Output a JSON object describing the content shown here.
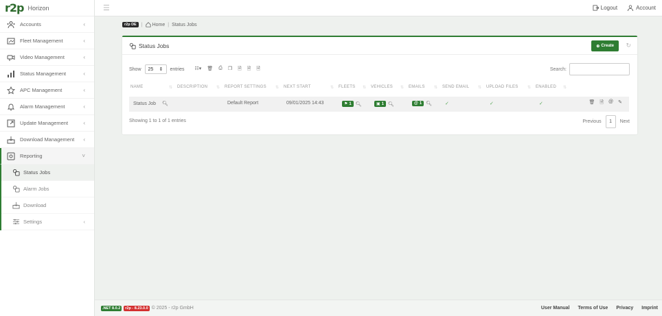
{
  "brand": {
    "logo": "r2p",
    "name": "Horizon"
  },
  "sidebar": {
    "items": [
      {
        "label": "Accounts"
      },
      {
        "label": "Fleet Management"
      },
      {
        "label": "Video Management"
      },
      {
        "label": "Status Management"
      },
      {
        "label": "APC Management"
      },
      {
        "label": "Alarm Management"
      },
      {
        "label": "Update Management"
      },
      {
        "label": "Download Management"
      },
      {
        "label": "Reporting"
      }
    ],
    "reporting_sub": [
      {
        "label": "Status Jobs"
      },
      {
        "label": "Alarm Jobs"
      },
      {
        "label": "Download"
      },
      {
        "label": "Settings"
      }
    ]
  },
  "topbar": {
    "logout": "Logout",
    "account": "Account"
  },
  "breadcrumb": {
    "tag": "r2p DE",
    "home": "Home",
    "current": "Status Jobs"
  },
  "card": {
    "title": "Status Jobs",
    "create": "Create",
    "show_label": "Show",
    "page_size": "25",
    "entries_label": "entries",
    "search_label": "Search:",
    "search_value": "",
    "columns": [
      "NAME",
      "DESCRIPTION",
      "REPORT SETTINGS",
      "NEXT START",
      "FLEETS",
      "VEHICLES",
      "EMAILS",
      "SEND EMAIL",
      "UPLOAD FILES",
      "ENABLED"
    ],
    "row": {
      "name": "Status Job",
      "description": "",
      "report_settings": "Default Report",
      "next_start": "09/01/2025 14:43",
      "fleets": "1",
      "vehicles": "1",
      "emails": "1"
    },
    "info": "Showing 1 to 1 of 1 entries",
    "pager": {
      "previous": "Previous",
      "page": "1",
      "next": "Next"
    }
  },
  "footer": {
    "net_version": ".NET 8.0.2",
    "app_version": "r2p - 8.23.0.0",
    "copyright": "© 2025 - r2p GmbH",
    "links": [
      "User Manual",
      "Terms of Use",
      "Privacy",
      "Imprint"
    ]
  },
  "colors": {
    "accent": "#2e7d32",
    "danger": "#d32f2f",
    "background": "#eef1ee"
  }
}
